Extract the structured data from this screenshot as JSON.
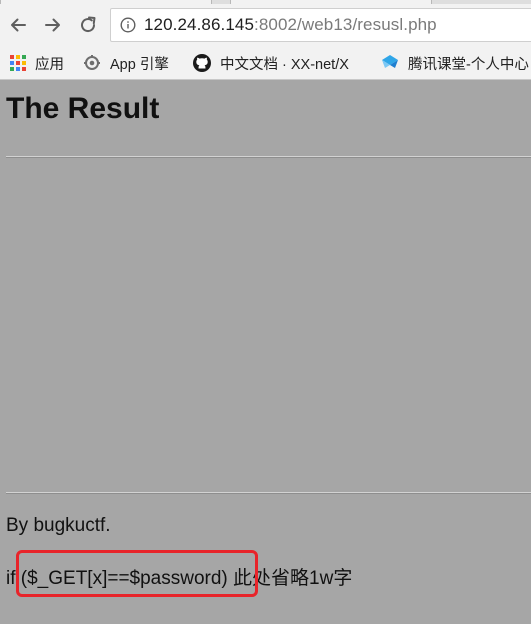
{
  "browser": {
    "url_host": "120.24.86.145",
    "url_rest": ":8002/web13/resusl.php",
    "bookmarks": [
      {
        "label": "应用",
        "icon": "apps-grid-icon"
      },
      {
        "label": "App 引擎",
        "icon": "app-engine-icon"
      },
      {
        "label": "中文文档 · XX-net/X",
        "icon": "github-icon"
      },
      {
        "label": "腾讯课堂-个人中心",
        "icon": "tencent-classroom-icon"
      }
    ]
  },
  "page": {
    "title": "The Result",
    "byline": "By bugkuctf.",
    "code_prefix": "if ",
    "code_condition": "($_GET[x]==$password)",
    "code_suffix": " 此处省略1w字"
  },
  "annotation": {
    "box_color": "#e8242a"
  }
}
